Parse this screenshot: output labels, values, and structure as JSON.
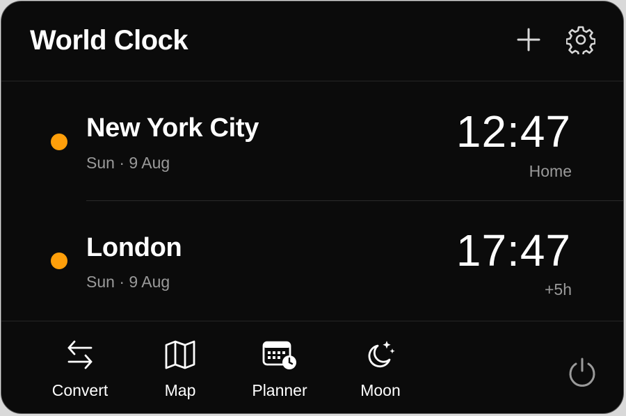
{
  "header": {
    "title": "World Clock",
    "add_icon": "plus-icon",
    "settings_icon": "gear-icon"
  },
  "clocks": [
    {
      "city": "New York City",
      "date": "Sun · 9 Aug",
      "time": "12:47",
      "offset": "Home",
      "indicator_color": "#ff9f0a"
    },
    {
      "city": "London",
      "date": "Sun · 9 Aug",
      "time": "17:47",
      "offset": "+5h",
      "indicator_color": "#ff9f0a"
    }
  ],
  "footer": {
    "tools": [
      {
        "label": "Convert",
        "icon": "swap-arrows-icon"
      },
      {
        "label": "Map",
        "icon": "map-icon"
      },
      {
        "label": "Planner",
        "icon": "calendar-clock-icon"
      },
      {
        "label": "Moon",
        "icon": "moon-stars-icon"
      }
    ],
    "power_icon": "power-icon"
  },
  "colors": {
    "background": "#0b0b0b",
    "accent": "#ff9f0a",
    "secondary_text": "#9a9a9a"
  }
}
